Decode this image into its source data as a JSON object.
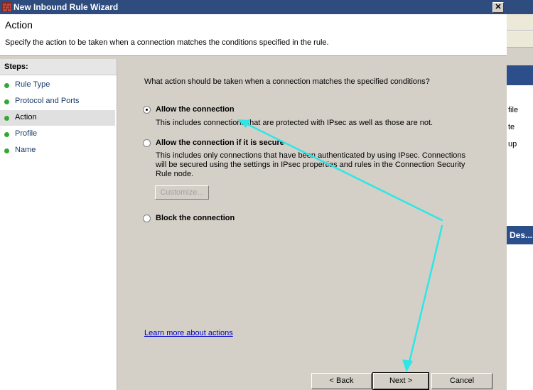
{
  "window": {
    "title": "New Inbound Rule Wizard",
    "close_glyph": "✕"
  },
  "header": {
    "title": "Action",
    "description": "Specify the action to be taken when a connection matches the conditions specified in the rule."
  },
  "sidebar": {
    "heading": "Steps:",
    "items": [
      {
        "label": "Rule Type",
        "active": false
      },
      {
        "label": "Protocol and Ports",
        "active": false
      },
      {
        "label": "Action",
        "active": true
      },
      {
        "label": "Profile",
        "active": false
      },
      {
        "label": "Name",
        "active": false
      }
    ]
  },
  "content": {
    "question": "What action should be taken when a connection matches the specified conditions?",
    "options": [
      {
        "label": "Allow the connection",
        "checked": true,
        "description": [
          "This includes connections that are protected with IPsec as well as those are not."
        ]
      },
      {
        "label": "Allow the connection if it is secure",
        "checked": false,
        "description": [
          "This includes only connections that have been authenticated by using IPsec.  Connections",
          "will be secured using the settings in IPsec properties and rules in the Connection Security",
          "Rule node."
        ]
      },
      {
        "label": "Block the connection",
        "checked": false,
        "description": []
      }
    ],
    "customize_label": "Customize...",
    "learn_more": "Learn more about actions"
  },
  "buttons": {
    "back": "< Back",
    "next": "Next >",
    "cancel": "Cancel"
  },
  "background_window": {
    "fragments": [
      "file",
      "te",
      "up",
      "Des..."
    ]
  },
  "colors": {
    "titlebar": "#2f4c7f",
    "step_dot": "#34a734",
    "annotation_arrow": "#2ee6e6",
    "link": "#0000cc"
  }
}
